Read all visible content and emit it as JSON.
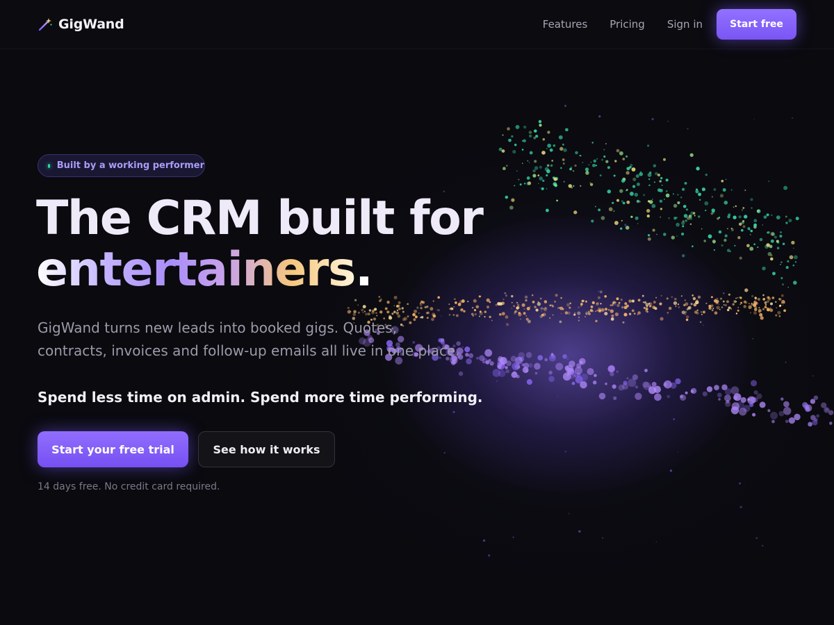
{
  "brand": {
    "name": "GigWand",
    "icon": "magic-wand-icon"
  },
  "nav": {
    "links": [
      "Features",
      "Pricing",
      "Sign in"
    ],
    "cta_label": "Start free"
  },
  "hero": {
    "badge": "Built by a working performer",
    "headline_line1": "The CRM built for",
    "headline_line2": "entertainers",
    "headline_punct": ".",
    "subtitle": "GigWand turns new leads into booked gigs. Quotes, contracts, invoices and follow-up emails all live in one place.",
    "tagline": "Spend less time on admin. Spend more time performing.",
    "primary_cta": "Start your free trial",
    "secondary_cta": "See how it works",
    "fineprint": "14 days free. No credit card required."
  },
  "colors": {
    "background": "#0a0a0f",
    "accent": "#7c5cff",
    "badge_dot": "#2ee0a8",
    "particle_teal": "#38d9a9",
    "particle_gold": "#f5b567",
    "particle_violet": "#b48cff"
  }
}
